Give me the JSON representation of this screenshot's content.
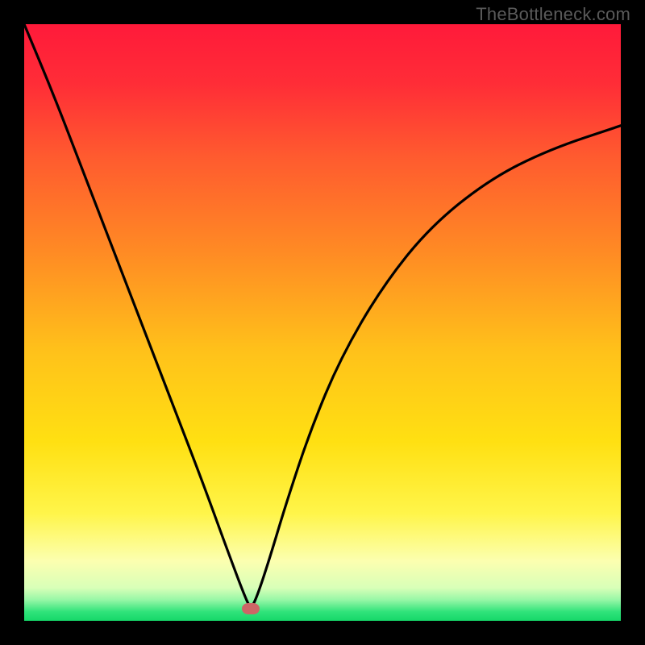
{
  "attribution": "TheBottleneck.com",
  "colors": {
    "frame": "#000000",
    "attribution_text": "#5a5a5a",
    "curve": "#000000",
    "marker": "#cc6666",
    "gradient_stops": [
      {
        "offset": 0.0,
        "color": "#ff1a3a"
      },
      {
        "offset": 0.1,
        "color": "#ff2d37"
      },
      {
        "offset": 0.22,
        "color": "#ff5a2f"
      },
      {
        "offset": 0.38,
        "color": "#ff8a24"
      },
      {
        "offset": 0.55,
        "color": "#ffc21a"
      },
      {
        "offset": 0.7,
        "color": "#ffe012"
      },
      {
        "offset": 0.82,
        "color": "#fff54a"
      },
      {
        "offset": 0.9,
        "color": "#fcffb0"
      },
      {
        "offset": 0.945,
        "color": "#d8ffb8"
      },
      {
        "offset": 0.965,
        "color": "#96f7a6"
      },
      {
        "offset": 0.985,
        "color": "#2fe37a"
      },
      {
        "offset": 1.0,
        "color": "#16d869"
      }
    ]
  },
  "chart_data": {
    "type": "line",
    "title": "",
    "xlabel": "",
    "ylabel": "",
    "xlim": [
      0,
      100
    ],
    "ylim": [
      0,
      100
    ],
    "grid": false,
    "legend": false,
    "annotations": [],
    "marker_point": {
      "x": 38,
      "y": 2
    },
    "series": [
      {
        "name": "bottleneck-curve",
        "x": [
          0,
          5,
          10,
          15,
          20,
          25,
          30,
          34,
          37,
          38,
          39,
          41,
          44,
          48,
          53,
          60,
          68,
          78,
          88,
          100
        ],
        "y": [
          100,
          88,
          75,
          62,
          49,
          36,
          23,
          12,
          4,
          2,
          4,
          10,
          20,
          32,
          44,
          56,
          66,
          74,
          79,
          83
        ]
      }
    ]
  }
}
